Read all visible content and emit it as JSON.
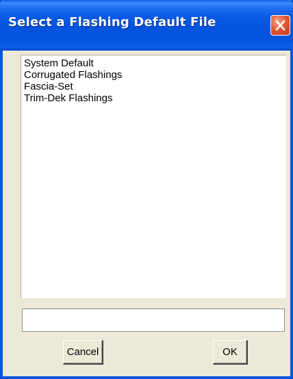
{
  "window": {
    "title": "Select a Flashing Default File",
    "close_icon": "close-icon"
  },
  "files": {
    "items": [
      "System Default",
      "Corrugated Flashings",
      "Fascia-Set",
      "Trim-Dek Flashings"
    ]
  },
  "filename_field": {
    "value": "",
    "placeholder": ""
  },
  "buttons": {
    "cancel_label": "Cancel",
    "ok_label": "OK"
  },
  "colors": {
    "titlebar": "#0454DF",
    "dialog_background": "#ECE9D8",
    "close_button": "#E25A36"
  }
}
